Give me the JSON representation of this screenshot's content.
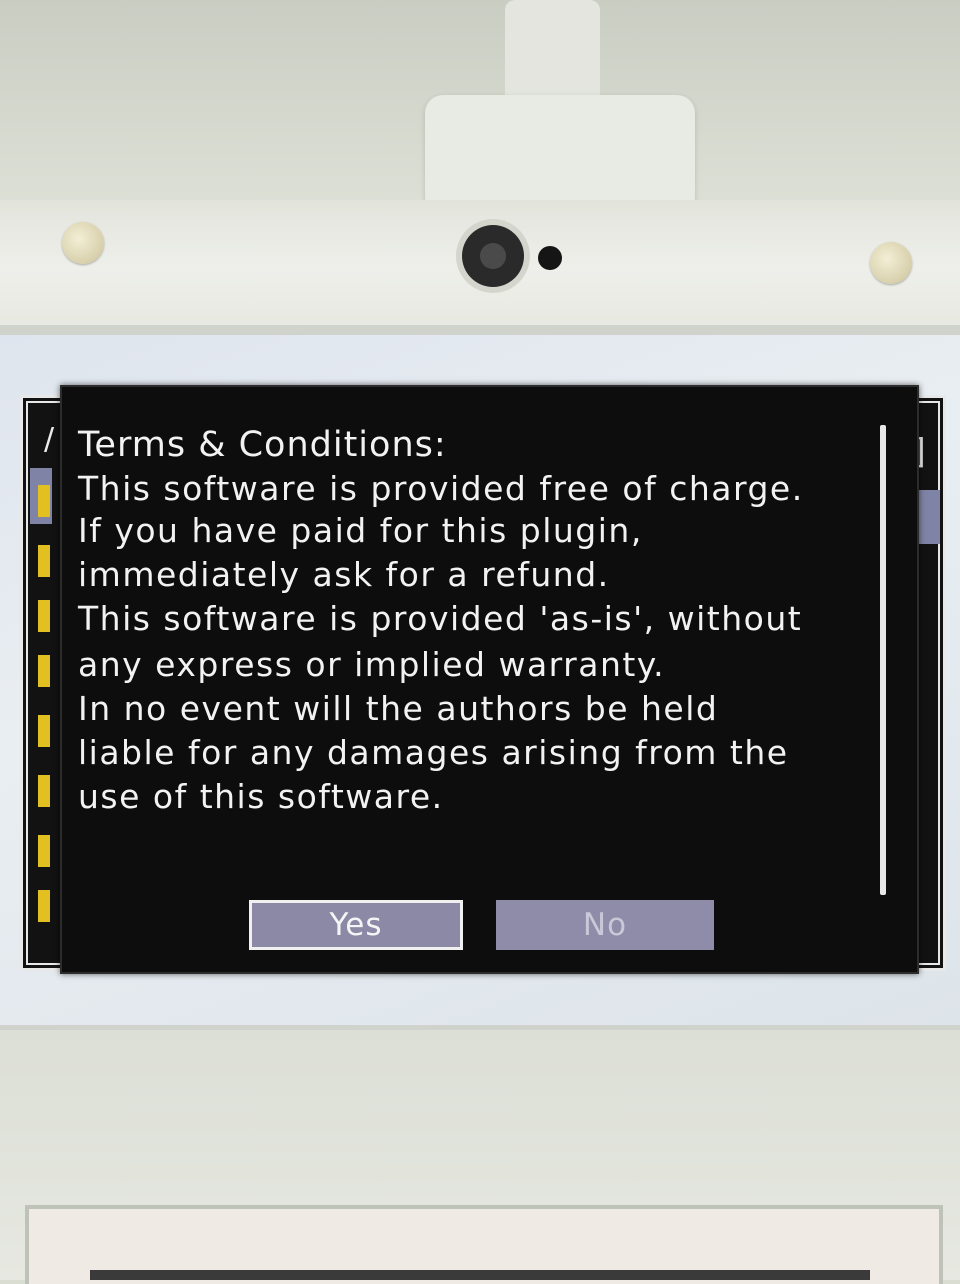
{
  "dialog": {
    "title": "Terms & Conditions:",
    "lines": [
      "This software is provided free of charge.",
      "If you have paid for this plugin,",
      "immediately ask for a refund.",
      "This software is provided 'as-is', without",
      "any express or implied warranty.",
      "In no event will the authors be held",
      "liable for any damages arising from the",
      "use of this software."
    ],
    "yes_label": "Yes",
    "no_label": "No"
  },
  "menu": {
    "bracket": "]",
    "initial": "/"
  },
  "colors": {
    "dialog_bg": "#0d0d0d",
    "text": "#f2f2f2",
    "button_bg": "#8c89a7",
    "marker": "#e3c022"
  }
}
